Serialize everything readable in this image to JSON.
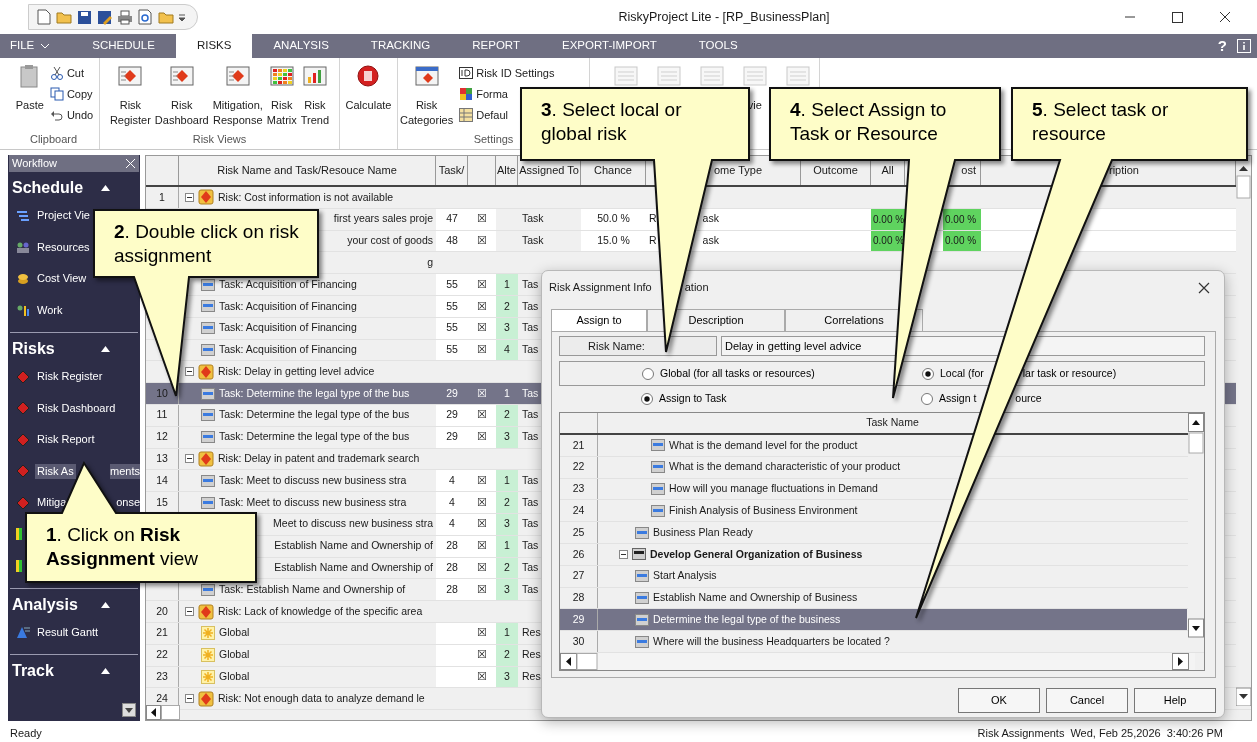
{
  "window": {
    "title": "RiskyProject Lite - [RP_BusinessPlan]"
  },
  "menu": {
    "tabs": [
      {
        "label": "FILE",
        "selected": false,
        "dropdown": true
      },
      {
        "label": "SCHEDULE",
        "selected": false,
        "dropdown": false
      },
      {
        "label": "RISKS",
        "selected": true,
        "dropdown": false
      },
      {
        "label": "ANALYSIS",
        "selected": false,
        "dropdown": false
      },
      {
        "label": "TRACKING",
        "selected": false,
        "dropdown": false
      },
      {
        "label": "REPORT",
        "selected": false,
        "dropdown": false
      },
      {
        "label": "EXPORT-IMPORT",
        "selected": false,
        "dropdown": false
      },
      {
        "label": "TOOLS",
        "selected": false,
        "dropdown": false
      }
    ],
    "help": "?"
  },
  "ribbon": {
    "groups": [
      {
        "label": "Clipboard",
        "large": [
          {
            "label": "Paste",
            "disabled": false
          }
        ],
        "small": [
          {
            "label": "Cut"
          },
          {
            "label": "Copy"
          },
          {
            "label": "Undo"
          }
        ]
      },
      {
        "label": "Risk Views",
        "large": [
          {
            "label": "Risk Register",
            "disabled": false
          },
          {
            "label": "Risk Dashboard",
            "disabled": false
          },
          {
            "label": "Mitigation, Response",
            "disabled": false
          },
          {
            "label": "Risk Matrix",
            "disabled": false
          },
          {
            "label": "Risk Trend",
            "disabled": false
          }
        ]
      },
      {
        "large": [
          {
            "label": "Calculate",
            "disabled": false
          }
        ]
      },
      {
        "label": "Settings",
        "large": [
          {
            "label": "Risk Categories",
            "disabled": false
          }
        ],
        "small": [
          {
            "label": "Risk ID Settings"
          },
          {
            "label": "Forma"
          },
          {
            "label": "Defaul"
          }
        ]
      },
      {
        "large": [
          {
            "disabled": true
          },
          {
            "disabled": true
          },
          {
            "disabled": true
          },
          {
            "label": "vie",
            "disabled": true
          },
          {
            "disabled": true
          }
        ]
      }
    ]
  },
  "sidebar": {
    "title": "Workflow",
    "sections": [
      {
        "title": "Schedule",
        "expanded": true,
        "items": [
          {
            "label": [
              "Project Vie"
            ],
            "selected": false
          },
          {
            "label": [
              "Resources"
            ],
            "selected": false
          },
          {
            "label": [
              "Cost View"
            ],
            "selected": false
          },
          {
            "label": [
              "Work"
            ],
            "selected": false
          }
        ]
      },
      {
        "title": "Risks",
        "expanded": true,
        "items": [
          {
            "label": [
              "Risk Register"
            ],
            "selected": false
          },
          {
            "label": [
              "Risk Dashboard"
            ],
            "selected": false
          },
          {
            "label": [
              "Risk Report"
            ],
            "selected": false
          },
          {
            "label": [
              "Risk As",
              "ments"
            ],
            "selected": true
          },
          {
            "label": [
              "Mitiga",
              "onse"
            ],
            "selected": false
          },
          {
            "selected": false
          },
          {
            "selected": false
          }
        ]
      },
      {
        "title": "Analysis",
        "expanded": true,
        "items": [
          {
            "label": [
              "Result Gantt"
            ],
            "selected": false
          }
        ]
      },
      {
        "title": "Track",
        "expanded": true
      }
    ]
  },
  "grid": {
    "columns": [
      {},
      {
        "label": "Risk Name and Task/Resouce Name"
      },
      {
        "label": "Task/"
      },
      {},
      {
        "label": "Alte"
      },
      {
        "label": "Assigned To"
      },
      {
        "label": "Chance"
      },
      {
        "label": "ome Type"
      },
      {
        "label": "Outcome"
      },
      {
        "label": "All"
      },
      {},
      {
        "label": "ost"
      },
      {
        "label": "ription"
      }
    ],
    "rows": [
      {
        "kind": "risk",
        "num": "1",
        "name": "Risk: Cost information is not available",
        "expanded": true,
        "selected": false
      },
      {
        "kind": "covered",
        "name": "first years sales proje",
        "task_no": "47",
        "mark": "☒",
        "assigned": "Task",
        "chance": "50.0 %",
        "outcome_type": [
          "R",
          "ask"
        ],
        "all": "0.00 %",
        "cost": "0.00 %",
        "selected": false
      },
      {
        "kind": "covered",
        "name": "your cost of goods",
        "task_no": "48",
        "mark": "☒",
        "assigned": "Task",
        "chance": "15.0 %",
        "outcome_type": [
          "R",
          "ask"
        ],
        "all": "0.00 %",
        "cost": "0.00 %",
        "selected": false
      },
      {
        "kind": "covered",
        "name": "g",
        "selected": false
      },
      {
        "kind": "task",
        "name": "Task: Acquisition of Financing",
        "task_no": "55",
        "mark": "☒",
        "alt": "1",
        "assigned": "Tas",
        "selected": false
      },
      {
        "kind": "task",
        "name": "Task: Acquisition of Financing",
        "task_no": "55",
        "mark": "☒",
        "alt": "2",
        "assigned": "Tas",
        "selected": false
      },
      {
        "kind": "task",
        "name": "Task: Acquisition of Financing",
        "task_no": "55",
        "mark": "☒",
        "alt": "3",
        "assigned": "Tas",
        "selected": false
      },
      {
        "kind": "task",
        "name": "Task: Acquisition of Financing",
        "task_no": "55",
        "mark": "☒",
        "alt": "4",
        "assigned": "Tas",
        "selected": false
      },
      {
        "kind": "risk",
        "name": "Risk: Delay in getting level advice",
        "expanded": true,
        "selected": false
      },
      {
        "kind": "task",
        "num": "10",
        "name": "Task: Determine the legal type of the bus",
        "task_no": "29",
        "mark": "☒",
        "alt": "1",
        "assigned": "Tas",
        "selected": true
      },
      {
        "kind": "task",
        "num": "11",
        "name": "Task: Determine the legal type of the bus",
        "task_no": "29",
        "mark": "☒",
        "alt": "2",
        "assigned": "Tas",
        "selected": false
      },
      {
        "kind": "task",
        "num": "12",
        "name": "Task: Determine the legal type of the bus",
        "task_no": "29",
        "mark": "☒",
        "alt": "3",
        "assigned": "Tas",
        "selected": false
      },
      {
        "kind": "risk",
        "num": "13",
        "name": "Risk: Delay in patent and trademark search",
        "expanded": true,
        "selected": false
      },
      {
        "kind": "task",
        "num": "14",
        "name": "Task: Meet to discuss new business stra",
        "task_no": "4",
        "mark": "☒",
        "alt": "1",
        "assigned": "Tas",
        "selected": false
      },
      {
        "kind": "task",
        "num": "15",
        "name": "Task: Meet to discuss new business stra",
        "task_no": "4",
        "mark": "☒",
        "alt": "2",
        "assigned": "Tas",
        "selected": false
      },
      {
        "kind": "covered",
        "name": "Meet to discuss new business stra",
        "task_no": "4",
        "mark": "☒",
        "alt": "3",
        "assigned": "Tas",
        "selected": false
      },
      {
        "kind": "covered",
        "name": "Establish Name and Ownership of",
        "task_no": "28",
        "mark": "☒",
        "alt": "1",
        "assigned": "Tas",
        "selected": false
      },
      {
        "kind": "covered",
        "name": "Establish Name and Ownership of",
        "task_no": "28",
        "mark": "☒",
        "alt": "2",
        "assigned": "Tas",
        "selected": false
      },
      {
        "kind": "task",
        "name": "Task: Establish Name and Ownership of",
        "task_no": "28",
        "mark": "☒",
        "alt": "3",
        "assigned": "Tas",
        "selected": false
      },
      {
        "kind": "risk",
        "num": "20",
        "name": "Risk: Lack of knowledge of the specific area",
        "expanded": true,
        "selected": false
      },
      {
        "kind": "global",
        "num": "21",
        "name": "Global",
        "mark": "☒",
        "alt": "1",
        "assigned": "Res",
        "selected": false
      },
      {
        "kind": "global",
        "num": "22",
        "name": "Global",
        "mark": "☒",
        "alt": "2",
        "assigned": "Res",
        "selected": false
      },
      {
        "kind": "global",
        "num": "23",
        "name": "Global",
        "mark": "☒",
        "alt": "3",
        "assigned": "Res",
        "selected": false
      },
      {
        "kind": "risk",
        "num": "24",
        "name": "Risk: Not enough data to analyze demand le",
        "expanded": true,
        "selected": false
      }
    ]
  },
  "dialog": {
    "title": [
      "Risk Assignment Info",
      "ation"
    ],
    "tabs": [
      {
        "label": "Assign to",
        "selected": true
      },
      {
        "label": "Description",
        "selected": false
      },
      {
        "label": "Correlations",
        "selected": false
      }
    ],
    "risk_name_label": "Risk Name:",
    "risk_name": "Delay in getting level advice",
    "scope_options": [
      {
        "label": [
          "Global (for all tasks or resources)"
        ],
        "selected": false
      },
      {
        "label": [
          "Local (for",
          "lar task or resource)"
        ],
        "selected": true
      }
    ],
    "assign_options": [
      {
        "label": [
          "Assign to Task"
        ],
        "selected": true
      },
      {
        "label": [
          "Assign t",
          "ource"
        ],
        "selected": false
      }
    ],
    "task_column": "Task Name",
    "tasks": [
      {
        "children": [
          {
            "children": [
              {
                "num": "21",
                "name": "What is the demand level for the product",
                "selected": false
              },
              {
                "num": "22",
                "name": "What is the demand characteristic of your product",
                "selected": false
              },
              {
                "num": "23",
                "name": "How will you manage fluctuations in Demand",
                "selected": false
              },
              {
                "num": "24",
                "name": "Finish Analysis of Business Environment",
                "selected": false
              }
            ]
          },
          {
            "num": "25",
            "name": "Business Plan Ready",
            "selected": false
          }
        ]
      },
      {
        "num": "26",
        "name": "Develop General Organization of Business",
        "selected": false,
        "expanded": true,
        "children": [
          {
            "num": "27",
            "name": "Start Analysis",
            "selected": false
          },
          {
            "num": "28",
            "name": "Establish Name and Ownership of Business",
            "selected": false
          },
          {
            "num": "29",
            "name": "Determine the legal type of the business",
            "selected": true
          },
          {
            "num": "30",
            "name": "Where will the business Headquarters be located ?",
            "selected": false
          }
        ]
      }
    ],
    "buttons": [
      "OK",
      "Cancel",
      "Help"
    ]
  },
  "callouts": [
    {
      "text": "**3**. Select local or global risk"
    },
    {
      "text": "**4**. Select Assign to Task or Resource"
    },
    {
      "text": "**5**. Select task or resource"
    },
    {
      "text": "**2**. Double click on risk assignment"
    },
    {
      "text": "**1**. Click on **Risk Assignment** view"
    }
  ],
  "status_bar": {
    "left": "Ready",
    "view": "Risk Assignments",
    "date": "Wed, Feb 25,2026",
    "time": "3:40:26 PM"
  }
}
